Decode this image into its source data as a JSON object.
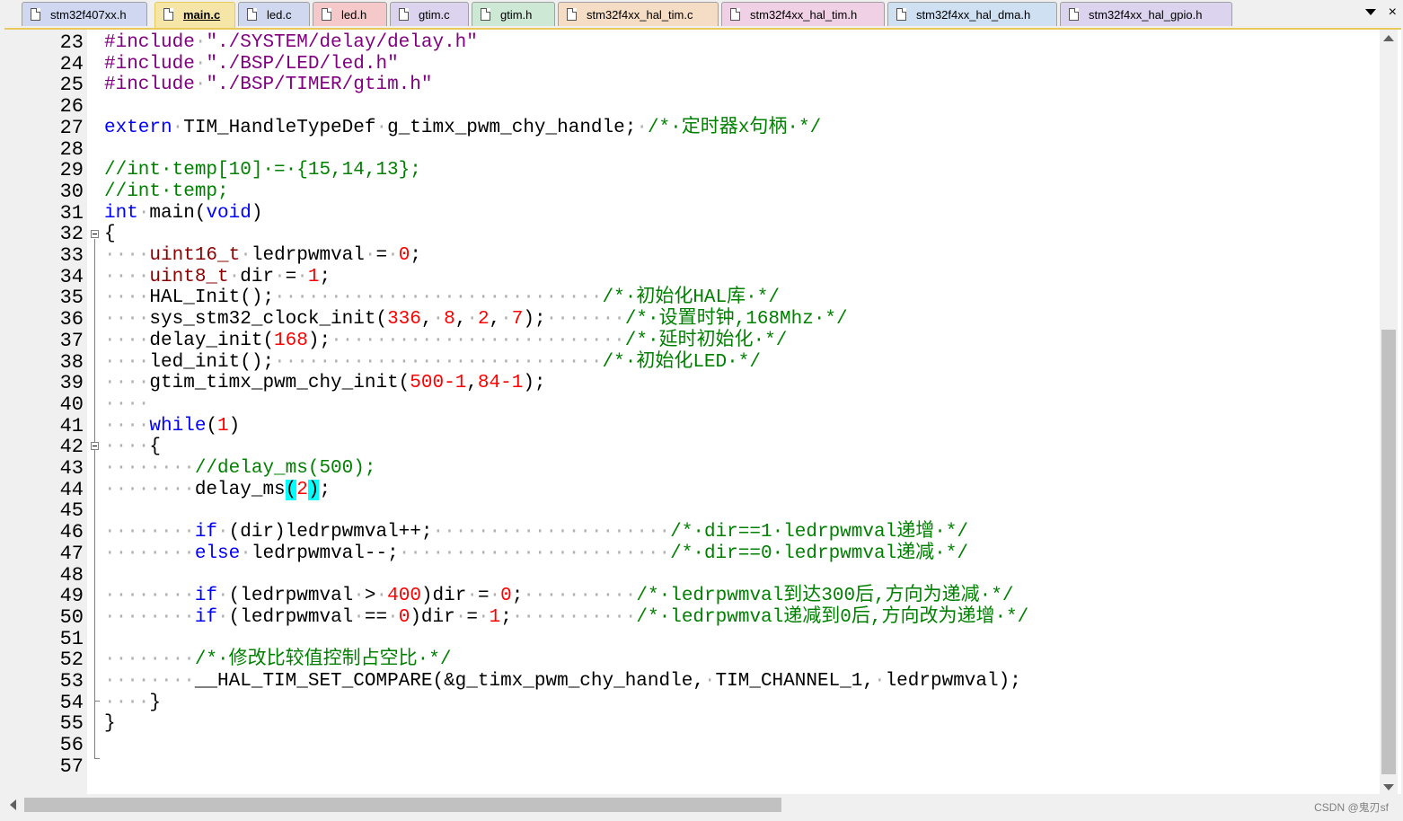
{
  "tabs": [
    {
      "label": "stm32f407xx.h",
      "color": "#cfd8f0",
      "active": false
    },
    {
      "label": "main.c",
      "color": "#f5e6a8",
      "active": true
    },
    {
      "label": "led.c",
      "color": "#d0d8f0",
      "active": false
    },
    {
      "label": "led.h",
      "color": "#f5c9c9",
      "active": false
    },
    {
      "label": "gtim.c",
      "color": "#dcd4ee",
      "active": false
    },
    {
      "label": "gtim.h",
      "color": "#cde8d4",
      "active": false
    },
    {
      "label": "stm32f4xx_hal_tim.c",
      "color": "#f5dcc4",
      "active": false
    },
    {
      "label": "stm32f4xx_hal_tim.h",
      "color": "#f0d0e4",
      "active": false
    },
    {
      "label": "stm32f4xx_hal_dma.h",
      "color": "#cfe0f2",
      "active": false
    },
    {
      "label": "stm32f4xx_hal_gpio.h",
      "color": "#dcd4ee",
      "active": false
    }
  ],
  "tab_dropdown_icon": "chevron-down-icon",
  "tab_close_label": "×",
  "line_numbers": [
    "23",
    "24",
    "25",
    "26",
    "27",
    "28",
    "29",
    "30",
    "31",
    "32",
    "33",
    "34",
    "35",
    "36",
    "37",
    "38",
    "39",
    "40",
    "41",
    "42",
    "43",
    "44",
    "45",
    "46",
    "47",
    "48",
    "49",
    "50",
    "51",
    "52",
    "53",
    "54",
    "55",
    "56",
    "57"
  ],
  "code_lines": [
    [
      {
        "t": "#include",
        "c": "p"
      },
      {
        "t": "·",
        "c": "ws"
      },
      {
        "t": "\"./SYSTEM/delay/delay.h\"",
        "c": "p"
      }
    ],
    [
      {
        "t": "#include",
        "c": "p"
      },
      {
        "t": "·",
        "c": "ws"
      },
      {
        "t": "\"./BSP/LED/led.h\"",
        "c": "p"
      }
    ],
    [
      {
        "t": "#include",
        "c": "p"
      },
      {
        "t": "·",
        "c": "ws"
      },
      {
        "t": "\"./BSP/TIMER/gtim.h\"",
        "c": "p"
      }
    ],
    [],
    [
      {
        "t": "extern",
        "c": "k"
      },
      {
        "t": "·",
        "c": "ws"
      },
      {
        "t": "TIM_HandleTypeDef",
        "c": ""
      },
      {
        "t": "·",
        "c": "ws"
      },
      {
        "t": "g_timx_pwm_chy_handle;",
        "c": ""
      },
      {
        "t": "·",
        "c": "ws"
      },
      {
        "t": "/*·定时器x句柄·*/",
        "c": "c"
      }
    ],
    [],
    [
      {
        "t": "//int·temp[10]·=·{15,14,13};",
        "c": "c"
      }
    ],
    [
      {
        "t": "//int·temp;",
        "c": "c"
      }
    ],
    [
      {
        "t": "int",
        "c": "k"
      },
      {
        "t": "·",
        "c": "ws"
      },
      {
        "t": "main(",
        "c": ""
      },
      {
        "t": "void",
        "c": "k"
      },
      {
        "t": ")",
        "c": ""
      }
    ],
    [
      {
        "t": "{",
        "c": ""
      }
    ],
    [
      {
        "t": "····",
        "c": "ws"
      },
      {
        "t": "uint16_t",
        "c": "t"
      },
      {
        "t": "·",
        "c": "ws"
      },
      {
        "t": "ledrpwmval",
        "c": ""
      },
      {
        "t": "·",
        "c": "ws"
      },
      {
        "t": "=",
        "c": ""
      },
      {
        "t": "·",
        "c": "ws"
      },
      {
        "t": "0",
        "c": "n"
      },
      {
        "t": ";",
        "c": ""
      }
    ],
    [
      {
        "t": "····",
        "c": "ws"
      },
      {
        "t": "uint8_t",
        "c": "t"
      },
      {
        "t": "·",
        "c": "ws"
      },
      {
        "t": "dir",
        "c": ""
      },
      {
        "t": "·",
        "c": "ws"
      },
      {
        "t": "=",
        "c": ""
      },
      {
        "t": "·",
        "c": "ws"
      },
      {
        "t": "1",
        "c": "n"
      },
      {
        "t": ";",
        "c": ""
      }
    ],
    [
      {
        "t": "····",
        "c": "ws"
      },
      {
        "t": "HAL_Init();",
        "c": ""
      },
      {
        "t": "·····························",
        "c": "ws"
      },
      {
        "t": "/*·初始化HAL库·*/",
        "c": "c"
      }
    ],
    [
      {
        "t": "····",
        "c": "ws"
      },
      {
        "t": "sys_stm32_clock_init(",
        "c": ""
      },
      {
        "t": "336",
        "c": "n"
      },
      {
        "t": ",",
        "c": ""
      },
      {
        "t": "·",
        "c": "ws"
      },
      {
        "t": "8",
        "c": "n"
      },
      {
        "t": ",",
        "c": ""
      },
      {
        "t": "·",
        "c": "ws"
      },
      {
        "t": "2",
        "c": "n"
      },
      {
        "t": ",",
        "c": ""
      },
      {
        "t": "·",
        "c": "ws"
      },
      {
        "t": "7",
        "c": "n"
      },
      {
        "t": ");",
        "c": ""
      },
      {
        "t": "·······",
        "c": "ws"
      },
      {
        "t": "/*·设置时钟,168Mhz·*/",
        "c": "c"
      }
    ],
    [
      {
        "t": "····",
        "c": "ws"
      },
      {
        "t": "delay_init(",
        "c": ""
      },
      {
        "t": "168",
        "c": "n"
      },
      {
        "t": ");",
        "c": ""
      },
      {
        "t": "··························",
        "c": "ws"
      },
      {
        "t": "/*·延时初始化·*/",
        "c": "c"
      }
    ],
    [
      {
        "t": "····",
        "c": "ws"
      },
      {
        "t": "led_init();",
        "c": ""
      },
      {
        "t": "·····························",
        "c": "ws"
      },
      {
        "t": "/*·初始化LED·*/",
        "c": "c"
      }
    ],
    [
      {
        "t": "····",
        "c": "ws"
      },
      {
        "t": "gtim_timx_pwm_chy_init(",
        "c": ""
      },
      {
        "t": "500-1",
        "c": "n"
      },
      {
        "t": ",",
        "c": ""
      },
      {
        "t": "84-1",
        "c": "n"
      },
      {
        "t": ");",
        "c": ""
      }
    ],
    [
      {
        "t": "····",
        "c": "ws"
      }
    ],
    [
      {
        "t": "····",
        "c": "ws"
      },
      {
        "t": "while",
        "c": "k"
      },
      {
        "t": "(",
        "c": ""
      },
      {
        "t": "1",
        "c": "n"
      },
      {
        "t": ")",
        "c": ""
      }
    ],
    [
      {
        "t": "····",
        "c": "ws"
      },
      {
        "t": "{",
        "c": ""
      }
    ],
    [
      {
        "t": "········",
        "c": "ws"
      },
      {
        "t": "//delay_ms(500);",
        "c": "c"
      }
    ],
    [
      {
        "t": "········",
        "c": "ws"
      },
      {
        "t": "delay_ms",
        "c": ""
      },
      {
        "t": "(",
        "c": "br"
      },
      {
        "t": "2",
        "c": "n"
      },
      {
        "t": ")",
        "c": "br"
      },
      {
        "t": ";",
        "c": ""
      }
    ],
    [],
    [
      {
        "t": "········",
        "c": "ws"
      },
      {
        "t": "if",
        "c": "k"
      },
      {
        "t": "·",
        "c": "ws"
      },
      {
        "t": "(dir)ledrpwmval++;",
        "c": ""
      },
      {
        "t": "·····················",
        "c": "ws"
      },
      {
        "t": "/*·dir==1·ledrpwmval递增·*/",
        "c": "c"
      }
    ],
    [
      {
        "t": "········",
        "c": "ws"
      },
      {
        "t": "else",
        "c": "k"
      },
      {
        "t": "·",
        "c": "ws"
      },
      {
        "t": "ledrpwmval--;",
        "c": ""
      },
      {
        "t": "························",
        "c": "ws"
      },
      {
        "t": "/*·dir==0·ledrpwmval递减·*/",
        "c": "c"
      }
    ],
    [],
    [
      {
        "t": "········",
        "c": "ws"
      },
      {
        "t": "if",
        "c": "k"
      },
      {
        "t": "·",
        "c": "ws"
      },
      {
        "t": "(ledrpwmval",
        "c": ""
      },
      {
        "t": "·",
        "c": "ws"
      },
      {
        "t": ">",
        "c": ""
      },
      {
        "t": "·",
        "c": "ws"
      },
      {
        "t": "400",
        "c": "n"
      },
      {
        "t": ")dir",
        "c": ""
      },
      {
        "t": "·",
        "c": "ws"
      },
      {
        "t": "=",
        "c": ""
      },
      {
        "t": "·",
        "c": "ws"
      },
      {
        "t": "0",
        "c": "n"
      },
      {
        "t": ";",
        "c": ""
      },
      {
        "t": "··········",
        "c": "ws"
      },
      {
        "t": "/*·ledrpwmval到达300后,方向为递减·*/",
        "c": "c"
      }
    ],
    [
      {
        "t": "········",
        "c": "ws"
      },
      {
        "t": "if",
        "c": "k"
      },
      {
        "t": "·",
        "c": "ws"
      },
      {
        "t": "(ledrpwmval",
        "c": ""
      },
      {
        "t": "·",
        "c": "ws"
      },
      {
        "t": "==",
        "c": ""
      },
      {
        "t": "·",
        "c": "ws"
      },
      {
        "t": "0",
        "c": "n"
      },
      {
        "t": ")dir",
        "c": ""
      },
      {
        "t": "·",
        "c": "ws"
      },
      {
        "t": "=",
        "c": ""
      },
      {
        "t": "·",
        "c": "ws"
      },
      {
        "t": "1",
        "c": "n"
      },
      {
        "t": ";",
        "c": ""
      },
      {
        "t": "···········",
        "c": "ws"
      },
      {
        "t": "/*·ledrpwmval递减到0后,方向改为递增·*/",
        "c": "c"
      }
    ],
    [],
    [
      {
        "t": "········",
        "c": "ws"
      },
      {
        "t": "/*·修改比较值控制占空比·*/",
        "c": "c"
      }
    ],
    [
      {
        "t": "········",
        "c": "ws"
      },
      {
        "t": "__HAL_TIM_SET_COMPARE(&g_timx_pwm_chy_handle,",
        "c": ""
      },
      {
        "t": "·",
        "c": "ws"
      },
      {
        "t": "TIM_CHANNEL_1,",
        "c": ""
      },
      {
        "t": "·",
        "c": "ws"
      },
      {
        "t": "ledrpwmval);",
        "c": ""
      }
    ],
    [
      {
        "t": "····",
        "c": "ws"
      },
      {
        "t": "}",
        "c": ""
      }
    ],
    [
      {
        "t": "}",
        "c": ""
      }
    ],
    [],
    []
  ],
  "watermark": "CSDN @鬼刃sf",
  "colors": {
    "keyword": "#0000ff",
    "preprocessor": "#800080",
    "comment": "#008000",
    "number": "#ff0000",
    "type": "#8b0000",
    "bracket_highlight": "#00ffff",
    "active_tab_border": "#e8c95c"
  }
}
